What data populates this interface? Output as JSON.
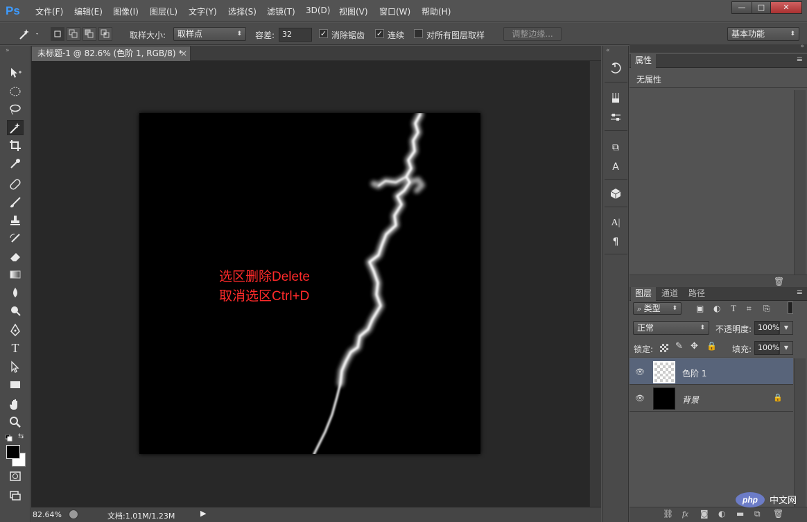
{
  "app": {
    "logo": "Ps"
  },
  "menu": [
    "文件(F)",
    "编辑(E)",
    "图像(I)",
    "图层(L)",
    "文字(Y)",
    "选择(S)",
    "滤镜(T)",
    "3D(D)",
    "视图(V)",
    "窗口(W)",
    "帮助(H)"
  ],
  "window": {
    "minimize": "—",
    "maximize": "□",
    "close": "✕"
  },
  "options": {
    "sample_size_label": "取样大小:",
    "sample_size_value": "取样点",
    "tolerance_label": "容差:",
    "tolerance_value": "32",
    "antialias_label": "消除锯齿",
    "contiguous_label": "连续",
    "all_layers_label": "对所有图层取样",
    "refine_edge": "调整边缘...",
    "workspace": "基本功能",
    "antialias_checked": true,
    "contiguous_checked": true,
    "all_layers_checked": false
  },
  "document": {
    "tab_title": "未标题-1 @ 82.6% (色阶 1, RGB/8) *",
    "tab_close": "×",
    "overlay_line1": "选区删除Delete",
    "overlay_line2": "取消选区Ctrl+D"
  },
  "status": {
    "zoom": "82.64%",
    "doc_info": "文档:1.01M/1.23M"
  },
  "properties": {
    "tab": "属性",
    "content": "无属性"
  },
  "layers_panel": {
    "tabs": [
      "图层",
      "通道",
      "路径"
    ],
    "filter_label": "类型",
    "blend_mode": "正常",
    "opacity_label": "不透明度:",
    "opacity_value": "100%",
    "lock_label": "锁定:",
    "fill_label": "填充:",
    "fill_value": "100%",
    "layers": [
      {
        "name": "色阶 1",
        "selected": true
      },
      {
        "name": "背景",
        "selected": false,
        "locked": true
      }
    ]
  },
  "watermark": "php 中文网"
}
